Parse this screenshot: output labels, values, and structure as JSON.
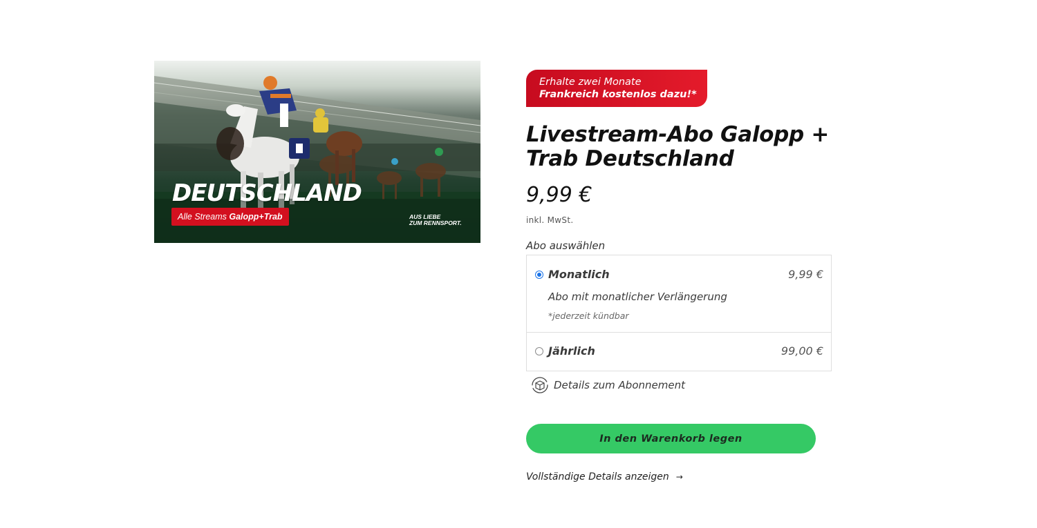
{
  "product_image": {
    "title": "DEUTSCHLAND",
    "tag_prefix": "Alle Streams",
    "tag_bold": "Galopp+Trab",
    "slogan_line1": "AUS LIEBE",
    "slogan_line2": "ZUM RENNSPORT."
  },
  "promo": {
    "line1": "Erhalte zwei Monate",
    "line2": "Frankreich kostenlos dazu!*"
  },
  "product": {
    "title": "Livestream-Abo Galopp + Trab Deutschland",
    "price": "9,99 €",
    "tax_note": "inkl. MwSt."
  },
  "plans": {
    "label": "Abo auswählen",
    "options": [
      {
        "name": "Monatlich",
        "price": "9,99 €",
        "description": "Abo mit monatlicher Verlängerung",
        "note": "*jederzeit kündbar",
        "selected": true
      },
      {
        "name": "Jährlich",
        "price": "99,00 €",
        "selected": false
      }
    ]
  },
  "subscription_details_label": "Details zum Abonnement",
  "cart_button_label": "In den Warenkorb legen",
  "full_details_label": "Vollständige Details anzeigen",
  "colors": {
    "promo_red": "#d3101f",
    "cart_green": "#35c965",
    "radio_blue": "#1a73e8"
  }
}
